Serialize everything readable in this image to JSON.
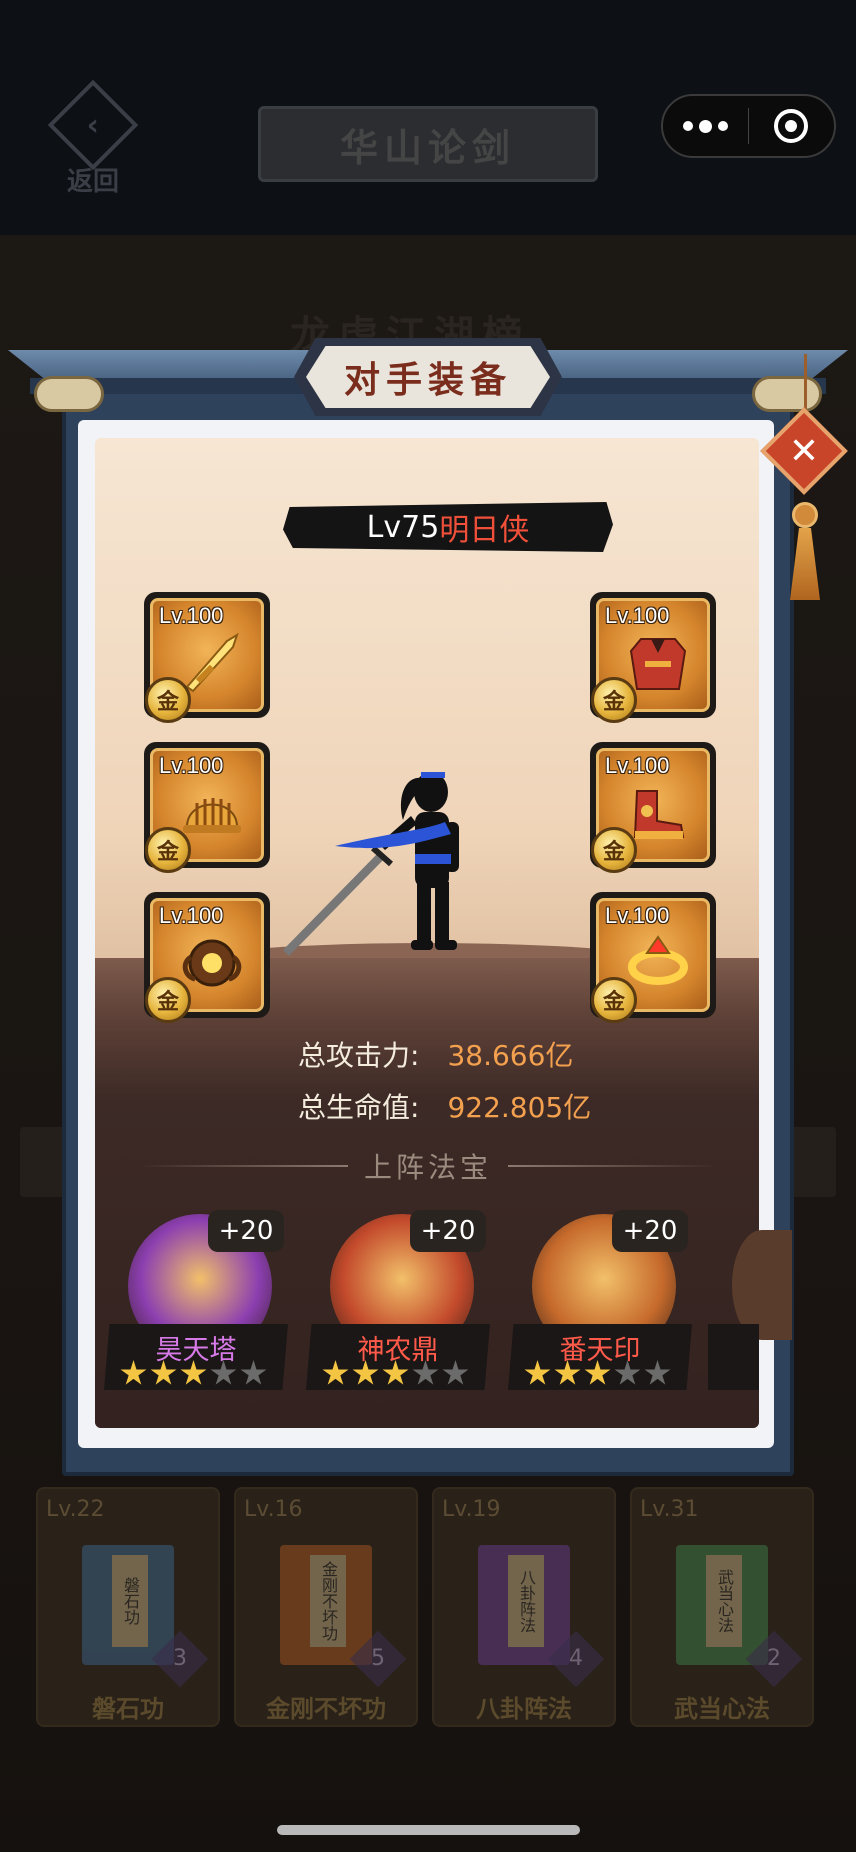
{
  "nav": {
    "back_label": "返回",
    "title": "华山论剑",
    "more_label": "•••",
    "close_label": "◎"
  },
  "background": {
    "rank_title": "龙虎江湖榜",
    "books": [
      {
        "level": "Lv.22",
        "cover": "磐石功",
        "num": "3",
        "name": "磐石功",
        "color": "#3d6b9a"
      },
      {
        "level": "Lv.16",
        "cover": "金刚不坏功",
        "num": "5",
        "name": "金刚不坏功",
        "color": "#b25a22"
      },
      {
        "level": "Lv.19",
        "cover": "八卦阵法",
        "num": "4",
        "name": "八卦阵法",
        "color": "#6a3d9a"
      },
      {
        "level": "Lv.31",
        "cover": "武当心法",
        "num": "2",
        "name": "武当心法",
        "color": "#3e8a4e"
      }
    ]
  },
  "modal": {
    "title": "对手装备",
    "close_icon": "x-icon",
    "player": {
      "level": "Lv75",
      "name": "明日侠"
    },
    "equipment": [
      {
        "slot": "weapon",
        "level": "Lv.100",
        "grade": "金",
        "icon": "sword-icon"
      },
      {
        "slot": "helmet",
        "level": "Lv.100",
        "grade": "金",
        "icon": "helmet-icon"
      },
      {
        "slot": "accessory",
        "level": "Lv.100",
        "grade": "金",
        "icon": "amulet-icon"
      },
      {
        "slot": "armor",
        "level": "Lv.100",
        "grade": "金",
        "icon": "armor-icon"
      },
      {
        "slot": "boots",
        "level": "Lv.100",
        "grade": "金",
        "icon": "boots-icon"
      },
      {
        "slot": "ring",
        "level": "Lv.100",
        "grade": "金",
        "icon": "ring-icon"
      }
    ],
    "stats": {
      "attack_label": "总攻击力:",
      "attack_value": "38.666亿",
      "hp_label": "总生命值:",
      "hp_value": "922.805亿"
    },
    "treasure_section_title": "上阵法宝",
    "treasures": [
      {
        "name": "昊天塔",
        "plus": "+20",
        "stars": 3,
        "max_stars": 5,
        "name_color": "#d77ae8",
        "orb_color": "#8c3fb0"
      },
      {
        "name": "神农鼎",
        "plus": "+20",
        "stars": 3,
        "max_stars": 5,
        "name_color": "#ff5a4a",
        "orb_color": "#c34a2c"
      },
      {
        "name": "番天印",
        "plus": "+20",
        "stars": 3,
        "max_stars": 5,
        "name_color": "#ff5a4a",
        "orb_color": "#c66a2c"
      }
    ]
  },
  "colors": {
    "accent_orange": "#f3a04f",
    "name_red": "#f0503a",
    "star_gold": "#f4c542"
  }
}
